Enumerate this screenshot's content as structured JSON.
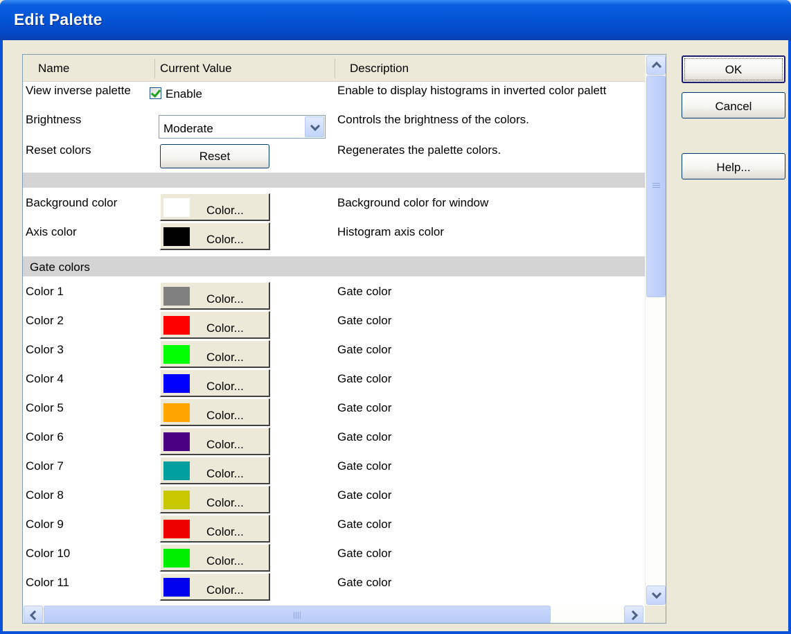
{
  "window": {
    "title": "Edit Palette"
  },
  "columns": {
    "name": "Name",
    "value": "Current Value",
    "description": "Description"
  },
  "settings": [
    {
      "name": "View inverse palette",
      "type": "checkbox",
      "checked": true,
      "value": "Enable",
      "description": "Enable to display histograms in inverted color palett"
    },
    {
      "name": "Brightness",
      "type": "dropdown",
      "value": "Moderate",
      "description": "Controls the brightness of the colors."
    },
    {
      "name": "Reset colors",
      "type": "button",
      "value": "Reset",
      "description": "Regenerates the palette colors."
    }
  ],
  "window_colors": [
    {
      "name": "Background color",
      "swatch": "#ffffff",
      "button": "Color...",
      "description": "Background color for window"
    },
    {
      "name": "Axis color",
      "swatch": "#000000",
      "button": "Color...",
      "description": "Histogram axis color"
    }
  ],
  "gate_section": {
    "label": "Gate colors"
  },
  "gate_colors": [
    {
      "name": "Color 1",
      "swatch": "#808080",
      "button": "Color...",
      "description": "Gate color"
    },
    {
      "name": "Color 2",
      "swatch": "#ff0000",
      "button": "Color...",
      "description": "Gate color"
    },
    {
      "name": "Color 3",
      "swatch": "#00ff00",
      "button": "Color...",
      "description": "Gate color"
    },
    {
      "name": "Color 4",
      "swatch": "#0000ff",
      "button": "Color...",
      "description": "Gate color"
    },
    {
      "name": "Color 5",
      "swatch": "#ffa500",
      "button": "Color...",
      "description": "Gate color"
    },
    {
      "name": "Color 6",
      "swatch": "#4b0082",
      "button": "Color...",
      "description": "Gate color"
    },
    {
      "name": "Color 7",
      "swatch": "#00a0a0",
      "button": "Color...",
      "description": "Gate color"
    },
    {
      "name": "Color 8",
      "swatch": "#c8c800",
      "button": "Color...",
      "description": "Gate color"
    },
    {
      "name": "Color 9",
      "swatch": "#ee0000",
      "button": "Color...",
      "description": "Gate color"
    },
    {
      "name": "Color 10",
      "swatch": "#00ee00",
      "button": "Color...",
      "description": "Gate color"
    },
    {
      "name": "Color 11",
      "swatch": "#0000ee",
      "button": "Color...",
      "description": "Gate color"
    }
  ],
  "buttons": {
    "ok": "OK",
    "cancel": "Cancel",
    "help": "Help..."
  }
}
